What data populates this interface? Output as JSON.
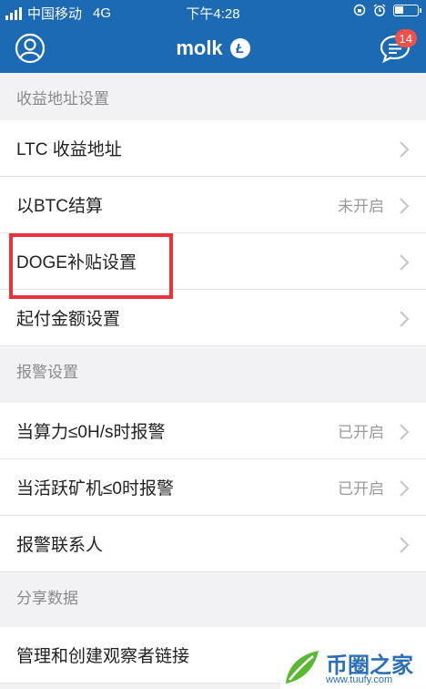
{
  "status_bar": {
    "carrier": "中国移动",
    "network": "4G",
    "time": "下午4:28"
  },
  "nav": {
    "title": "molk",
    "coin_badge": "Ł",
    "notifications_count": "14",
    "user_icon": "user-circle-icon",
    "message_icon": "message-bubble-icon"
  },
  "sections": [
    {
      "header": "收益地址设置",
      "items": [
        {
          "label": "LTC 收益地址",
          "value": ""
        },
        {
          "label": "以BTC结算",
          "value": "未开启"
        },
        {
          "label": "DOGE补贴设置",
          "value": ""
        },
        {
          "label": "起付金额设置",
          "value": ""
        }
      ]
    },
    {
      "header": "报警设置",
      "items": [
        {
          "label": "当算力≤0H/s时报警",
          "value": "已开启"
        },
        {
          "label": "当活跃矿机≤0时报警",
          "value": "已开启"
        },
        {
          "label": "报警联系人",
          "value": ""
        }
      ]
    },
    {
      "header": "分享数据",
      "items": [
        {
          "label": "管理和创建观察者链接",
          "value": ""
        }
      ]
    }
  ],
  "watermark": {
    "brand": "币圈之家",
    "url": "www.tuufy.com"
  },
  "colors": {
    "nav_bg": "#1c6ab4",
    "highlight_border": "#e8323c",
    "badge_bg": "#f0504a"
  }
}
